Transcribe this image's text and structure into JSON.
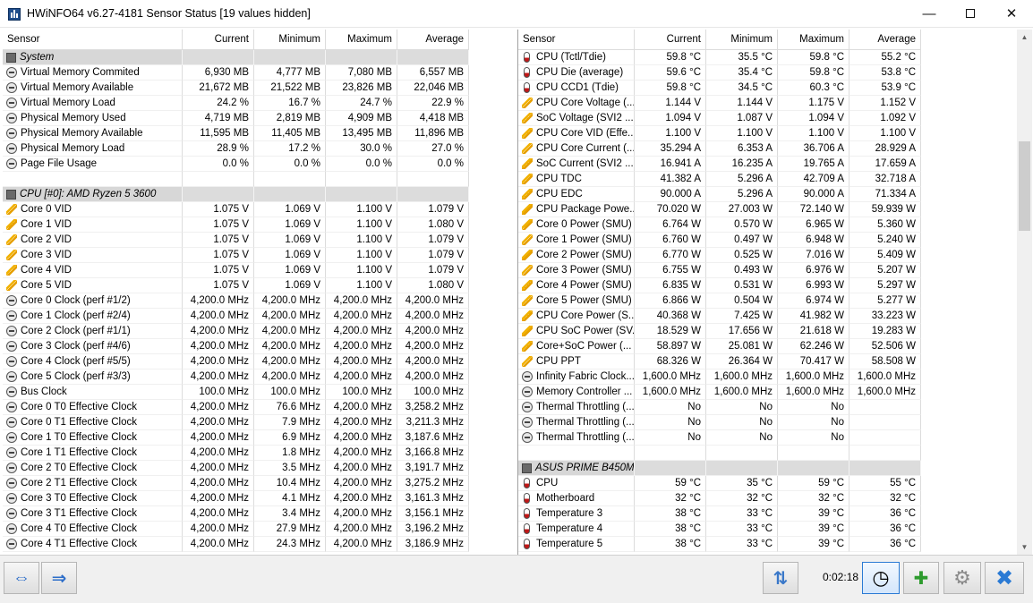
{
  "window": {
    "title": "HWiNFO64 v6.27-4181 Sensor Status [19 values hidden]"
  },
  "columns": [
    "Sensor",
    "Current",
    "Minimum",
    "Maximum",
    "Average"
  ],
  "left_rows": [
    {
      "type": "group",
      "icon": "chip-icon",
      "name": "System"
    },
    {
      "icon": "clock-icon",
      "name": "Virtual Memory Commited",
      "cur": "6,930 MB",
      "min": "4,777 MB",
      "max": "7,080 MB",
      "avg": "6,557 MB"
    },
    {
      "icon": "clock-icon",
      "name": "Virtual Memory Available",
      "cur": "21,672 MB",
      "min": "21,522 MB",
      "max": "23,826 MB",
      "avg": "22,046 MB"
    },
    {
      "icon": "clock-icon",
      "name": "Virtual Memory Load",
      "cur": "24.2 %",
      "min": "16.7 %",
      "max": "24.7 %",
      "avg": "22.9 %"
    },
    {
      "icon": "clock-icon",
      "name": "Physical Memory Used",
      "cur": "4,719 MB",
      "min": "2,819 MB",
      "max": "4,909 MB",
      "avg": "4,418 MB"
    },
    {
      "icon": "clock-icon",
      "name": "Physical Memory Available",
      "cur": "11,595 MB",
      "min": "11,405 MB",
      "max": "13,495 MB",
      "avg": "11,896 MB"
    },
    {
      "icon": "clock-icon",
      "name": "Physical Memory Load",
      "cur": "28.9 %",
      "min": "17.2 %",
      "max": "30.0 %",
      "avg": "27.0 %"
    },
    {
      "icon": "clock-icon",
      "name": "Page File Usage",
      "cur": "0.0 %",
      "min": "0.0 %",
      "max": "0.0 %",
      "avg": "0.0 %"
    },
    {
      "type": "blank"
    },
    {
      "type": "group",
      "icon": "chip-icon",
      "name": "CPU [#0]: AMD Ryzen 5 3600"
    },
    {
      "icon": "bolt-icon",
      "name": "Core 0 VID",
      "cur": "1.075 V",
      "min": "1.069 V",
      "max": "1.100 V",
      "avg": "1.079 V"
    },
    {
      "icon": "bolt-icon",
      "name": "Core 1 VID",
      "cur": "1.075 V",
      "min": "1.069 V",
      "max": "1.100 V",
      "avg": "1.080 V"
    },
    {
      "icon": "bolt-icon",
      "name": "Core 2 VID",
      "cur": "1.075 V",
      "min": "1.069 V",
      "max": "1.100 V",
      "avg": "1.079 V"
    },
    {
      "icon": "bolt-icon",
      "name": "Core 3 VID",
      "cur": "1.075 V",
      "min": "1.069 V",
      "max": "1.100 V",
      "avg": "1.079 V"
    },
    {
      "icon": "bolt-icon",
      "name": "Core 4 VID",
      "cur": "1.075 V",
      "min": "1.069 V",
      "max": "1.100 V",
      "avg": "1.079 V"
    },
    {
      "icon": "bolt-icon",
      "name": "Core 5 VID",
      "cur": "1.075 V",
      "min": "1.069 V",
      "max": "1.100 V",
      "avg": "1.080 V"
    },
    {
      "icon": "clock-icon",
      "name": "Core 0 Clock (perf #1/2)",
      "cur": "4,200.0 MHz",
      "min": "4,200.0 MHz",
      "max": "4,200.0 MHz",
      "avg": "4,200.0 MHz"
    },
    {
      "icon": "clock-icon",
      "name": "Core 1 Clock (perf #2/4)",
      "cur": "4,200.0 MHz",
      "min": "4,200.0 MHz",
      "max": "4,200.0 MHz",
      "avg": "4,200.0 MHz"
    },
    {
      "icon": "clock-icon",
      "name": "Core 2 Clock (perf #1/1)",
      "cur": "4,200.0 MHz",
      "min": "4,200.0 MHz",
      "max": "4,200.0 MHz",
      "avg": "4,200.0 MHz"
    },
    {
      "icon": "clock-icon",
      "name": "Core 3 Clock (perf #4/6)",
      "cur": "4,200.0 MHz",
      "min": "4,200.0 MHz",
      "max": "4,200.0 MHz",
      "avg": "4,200.0 MHz"
    },
    {
      "icon": "clock-icon",
      "name": "Core 4 Clock (perf #5/5)",
      "cur": "4,200.0 MHz",
      "min": "4,200.0 MHz",
      "max": "4,200.0 MHz",
      "avg": "4,200.0 MHz"
    },
    {
      "icon": "clock-icon",
      "name": "Core 5 Clock (perf #3/3)",
      "cur": "4,200.0 MHz",
      "min": "4,200.0 MHz",
      "max": "4,200.0 MHz",
      "avg": "4,200.0 MHz"
    },
    {
      "icon": "clock-icon",
      "name": "Bus Clock",
      "cur": "100.0 MHz",
      "min": "100.0 MHz",
      "max": "100.0 MHz",
      "avg": "100.0 MHz"
    },
    {
      "icon": "clock-icon",
      "name": "Core 0 T0 Effective Clock",
      "cur": "4,200.0 MHz",
      "min": "76.6 MHz",
      "max": "4,200.0 MHz",
      "avg": "3,258.2 MHz"
    },
    {
      "icon": "clock-icon",
      "name": "Core 0 T1 Effective Clock",
      "cur": "4,200.0 MHz",
      "min": "7.9 MHz",
      "max": "4,200.0 MHz",
      "avg": "3,211.3 MHz"
    },
    {
      "icon": "clock-icon",
      "name": "Core 1 T0 Effective Clock",
      "cur": "4,200.0 MHz",
      "min": "6.9 MHz",
      "max": "4,200.0 MHz",
      "avg": "3,187.6 MHz"
    },
    {
      "icon": "clock-icon",
      "name": "Core 1 T1 Effective Clock",
      "cur": "4,200.0 MHz",
      "min": "1.8 MHz",
      "max": "4,200.0 MHz",
      "avg": "3,166.8 MHz"
    },
    {
      "icon": "clock-icon",
      "name": "Core 2 T0 Effective Clock",
      "cur": "4,200.0 MHz",
      "min": "3.5 MHz",
      "max": "4,200.0 MHz",
      "avg": "3,191.7 MHz"
    },
    {
      "icon": "clock-icon",
      "name": "Core 2 T1 Effective Clock",
      "cur": "4,200.0 MHz",
      "min": "10.4 MHz",
      "max": "4,200.0 MHz",
      "avg": "3,275.2 MHz"
    },
    {
      "icon": "clock-icon",
      "name": "Core 3 T0 Effective Clock",
      "cur": "4,200.0 MHz",
      "min": "4.1 MHz",
      "max": "4,200.0 MHz",
      "avg": "3,161.3 MHz"
    },
    {
      "icon": "clock-icon",
      "name": "Core 3 T1 Effective Clock",
      "cur": "4,200.0 MHz",
      "min": "3.4 MHz",
      "max": "4,200.0 MHz",
      "avg": "3,156.1 MHz"
    },
    {
      "icon": "clock-icon",
      "name": "Core 4 T0 Effective Clock",
      "cur": "4,200.0 MHz",
      "min": "27.9 MHz",
      "max": "4,200.0 MHz",
      "avg": "3,196.2 MHz"
    },
    {
      "icon": "clock-icon",
      "name": "Core 4 T1 Effective Clock",
      "cur": "4,200.0 MHz",
      "min": "24.3 MHz",
      "max": "4,200.0 MHz",
      "avg": "3,186.9 MHz"
    }
  ],
  "right_rows": [
    {
      "icon": "thermometer-icon",
      "name": "CPU (Tctl/Tdie)",
      "cur": "59.8 °C",
      "min": "35.5 °C",
      "max": "59.8 °C",
      "avg": "55.2 °C"
    },
    {
      "icon": "thermometer-icon",
      "name": "CPU Die (average)",
      "cur": "59.6 °C",
      "min": "35.4 °C",
      "max": "59.8 °C",
      "avg": "53.8 °C"
    },
    {
      "icon": "thermometer-icon",
      "name": "CPU CCD1 (Tdie)",
      "cur": "59.8 °C",
      "min": "34.5 °C",
      "max": "60.3 °C",
      "avg": "53.9 °C"
    },
    {
      "icon": "bolt-icon",
      "name": "CPU Core Voltage (...",
      "cur": "1.144 V",
      "min": "1.144 V",
      "max": "1.175 V",
      "avg": "1.152 V"
    },
    {
      "icon": "bolt-icon",
      "name": "SoC Voltage (SVI2 ...",
      "cur": "1.094 V",
      "min": "1.087 V",
      "max": "1.094 V",
      "avg": "1.092 V"
    },
    {
      "icon": "bolt-icon",
      "name": "CPU Core VID (Effe...",
      "cur": "1.100 V",
      "min": "1.100 V",
      "max": "1.100 V",
      "avg": "1.100 V"
    },
    {
      "icon": "bolt-icon",
      "name": "CPU Core Current (...",
      "cur": "35.294 A",
      "min": "6.353 A",
      "max": "36.706 A",
      "avg": "28.929 A"
    },
    {
      "icon": "bolt-icon",
      "name": "SoC Current (SVI2 ...",
      "cur": "16.941 A",
      "min": "16.235 A",
      "max": "19.765 A",
      "avg": "17.659 A"
    },
    {
      "icon": "bolt-icon",
      "name": "CPU TDC",
      "cur": "41.382 A",
      "min": "5.296 A",
      "max": "42.709 A",
      "avg": "32.718 A"
    },
    {
      "icon": "bolt-icon",
      "name": "CPU EDC",
      "cur": "90.000 A",
      "min": "5.296 A",
      "max": "90.000 A",
      "avg": "71.334 A"
    },
    {
      "icon": "bolt-icon",
      "name": "CPU Package Powe...",
      "cur": "70.020 W",
      "min": "27.003 W",
      "max": "72.140 W",
      "avg": "59.939 W"
    },
    {
      "icon": "bolt-icon",
      "name": "Core 0 Power (SMU)",
      "cur": "6.764 W",
      "min": "0.570 W",
      "max": "6.965 W",
      "avg": "5.360 W"
    },
    {
      "icon": "bolt-icon",
      "name": "Core 1 Power (SMU)",
      "cur": "6.760 W",
      "min": "0.497 W",
      "max": "6.948 W",
      "avg": "5.240 W"
    },
    {
      "icon": "bolt-icon",
      "name": "Core 2 Power (SMU)",
      "cur": "6.770 W",
      "min": "0.525 W",
      "max": "7.016 W",
      "avg": "5.409 W"
    },
    {
      "icon": "bolt-icon",
      "name": "Core 3 Power (SMU)",
      "cur": "6.755 W",
      "min": "0.493 W",
      "max": "6.976 W",
      "avg": "5.207 W"
    },
    {
      "icon": "bolt-icon",
      "name": "Core 4 Power (SMU)",
      "cur": "6.835 W",
      "min": "0.531 W",
      "max": "6.993 W",
      "avg": "5.297 W"
    },
    {
      "icon": "bolt-icon",
      "name": "Core 5 Power (SMU)",
      "cur": "6.866 W",
      "min": "0.504 W",
      "max": "6.974 W",
      "avg": "5.277 W"
    },
    {
      "icon": "bolt-icon",
      "name": "CPU Core Power (S...",
      "cur": "40.368 W",
      "min": "7.425 W",
      "max": "41.982 W",
      "avg": "33.223 W"
    },
    {
      "icon": "bolt-icon",
      "name": "CPU SoC Power (SV...",
      "cur": "18.529 W",
      "min": "17.656 W",
      "max": "21.618 W",
      "avg": "19.283 W"
    },
    {
      "icon": "bolt-icon",
      "name": "Core+SoC Power (...",
      "cur": "58.897 W",
      "min": "25.081 W",
      "max": "62.246 W",
      "avg": "52.506 W"
    },
    {
      "icon": "bolt-icon",
      "name": "CPU PPT",
      "cur": "68.326 W",
      "min": "26.364 W",
      "max": "70.417 W",
      "avg": "58.508 W"
    },
    {
      "icon": "clock-icon",
      "name": "Infinity Fabric Clock...",
      "cur": "1,600.0 MHz",
      "min": "1,600.0 MHz",
      "max": "1,600.0 MHz",
      "avg": "1,600.0 MHz"
    },
    {
      "icon": "clock-icon",
      "name": "Memory Controller ...",
      "cur": "1,600.0 MHz",
      "min": "1,600.0 MHz",
      "max": "1,600.0 MHz",
      "avg": "1,600.0 MHz"
    },
    {
      "icon": "clock-icon",
      "name": "Thermal Throttling (...",
      "cur": "No",
      "min": "No",
      "max": "No",
      "avg": ""
    },
    {
      "icon": "clock-icon",
      "name": "Thermal Throttling (...",
      "cur": "No",
      "min": "No",
      "max": "No",
      "avg": ""
    },
    {
      "icon": "clock-icon",
      "name": "Thermal Throttling (...",
      "cur": "No",
      "min": "No",
      "max": "No",
      "avg": ""
    },
    {
      "type": "blank"
    },
    {
      "type": "group",
      "icon": "chip-icon",
      "name": "ASUS PRIME B450M..."
    },
    {
      "icon": "thermometer-icon",
      "name": "CPU",
      "cur": "59 °C",
      "min": "35 °C",
      "max": "59 °C",
      "avg": "55 °C"
    },
    {
      "icon": "thermometer-icon",
      "name": "Motherboard",
      "cur": "32 °C",
      "min": "32 °C",
      "max": "32 °C",
      "avg": "32 °C"
    },
    {
      "icon": "thermometer-icon",
      "name": "Temperature 3",
      "cur": "38 °C",
      "min": "33 °C",
      "max": "39 °C",
      "avg": "36 °C"
    },
    {
      "icon": "thermometer-icon",
      "name": "Temperature 4",
      "cur": "38 °C",
      "min": "33 °C",
      "max": "39 °C",
      "avg": "36 °C"
    },
    {
      "icon": "thermometer-icon",
      "name": "Temperature 5",
      "cur": "38 °C",
      "min": "33 °C",
      "max": "39 °C",
      "avg": "36 °C"
    }
  ],
  "bottom": {
    "timer": "0:02:18"
  }
}
